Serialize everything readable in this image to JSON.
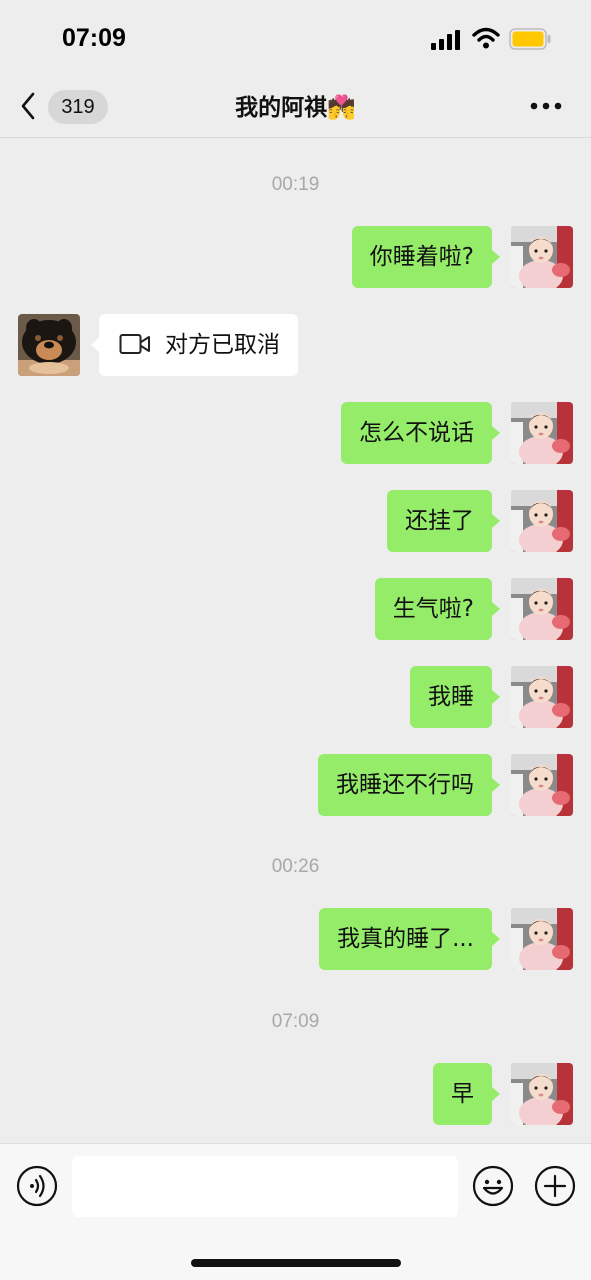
{
  "status_bar": {
    "time": "07:09",
    "icons": [
      "signal-icon",
      "wifi-icon",
      "battery-icon"
    ],
    "battery_color": "#ffc800"
  },
  "nav": {
    "unread_count": "319",
    "title": "我的阿祺💏",
    "back_icon": "chevron-left-icon",
    "more_icon": "more-dots-icon"
  },
  "messages": [
    {
      "type": "time",
      "text": "00:19"
    },
    {
      "type": "msg",
      "from": "self",
      "text": "你睡着啦?"
    },
    {
      "type": "call",
      "from": "other",
      "text": "对方已取消",
      "icon": "video-call-icon"
    },
    {
      "type": "msg",
      "from": "self",
      "text": "怎么不说话"
    },
    {
      "type": "msg",
      "from": "self",
      "text": "还挂了"
    },
    {
      "type": "msg",
      "from": "self",
      "text": "生气啦?"
    },
    {
      "type": "msg",
      "from": "self",
      "text": "我睡"
    },
    {
      "type": "msg",
      "from": "self",
      "text": "我睡还不行吗"
    },
    {
      "type": "time",
      "text": "00:26"
    },
    {
      "type": "msg",
      "from": "self",
      "text": "我真的睡了..."
    },
    {
      "type": "time",
      "text": "07:09"
    },
    {
      "type": "msg",
      "from": "self",
      "text": "早"
    }
  ],
  "input_bar": {
    "value": "",
    "placeholder": "",
    "icons": [
      "voice-icon",
      "emoji-icon",
      "plus-icon"
    ]
  },
  "colors": {
    "self_bubble": "#95ec69",
    "other_bubble": "#ffffff",
    "background": "#ededed",
    "timestamp": "#a8a8a8"
  }
}
